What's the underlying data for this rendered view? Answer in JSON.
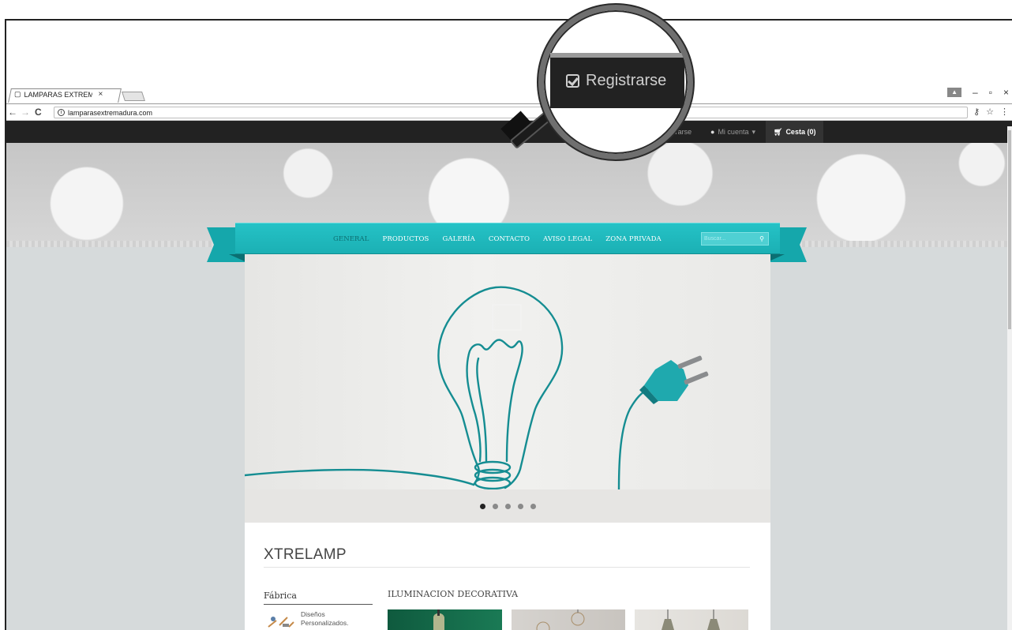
{
  "browser": {
    "tab_title": "LAMPARAS EXTREMADU",
    "tab_close": "×",
    "url": "lamparasextremadura.com",
    "back": "←",
    "forward": "→",
    "reload": "C",
    "info": "i",
    "window_minimize": "–",
    "window_restore": "▫",
    "window_close": "×",
    "key_icon": "key-icon",
    "star": "☆",
    "menu": "⋮"
  },
  "topbar": {
    "register_label": "Registrarse",
    "account_label": "Mi cuenta",
    "account_caret": "▾",
    "cart_label": "Cesta (0)"
  },
  "magnifier": {
    "label": "Registrarse"
  },
  "nav": {
    "items": [
      "GENERAL",
      "PRODUCTOS",
      "GALERÍA",
      "CONTACTO",
      "AVISO LEGAL",
      "ZONA PRIVADA"
    ],
    "active_index": 0,
    "search_placeholder": "Buscar..."
  },
  "slider": {
    "dots": 5,
    "active_dot": 0
  },
  "content": {
    "site_title": "XTRELAMP",
    "sidebar_heading": "Fábrica",
    "sidebar_item_line1": "Diseños",
    "sidebar_item_line2": "Personalizados.",
    "section_heading": "ILUMINACION DECORATIVA"
  },
  "colors": {
    "accent": "#1bb0b4",
    "topbar": "#222222",
    "page_bg": "#d6dadb"
  }
}
